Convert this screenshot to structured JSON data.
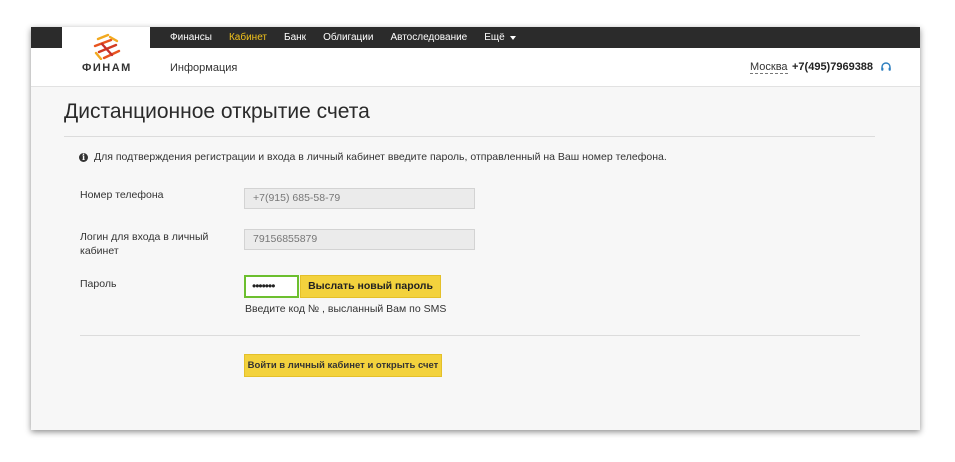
{
  "header": {
    "logo_text": "ФИНАМ",
    "top_nav": [
      {
        "label": "Финансы",
        "active": false
      },
      {
        "label": "Кабинет",
        "active": true
      },
      {
        "label": "Банк",
        "active": false
      },
      {
        "label": "Облигации",
        "active": false
      },
      {
        "label": "Автоследование",
        "active": false
      },
      {
        "label": "Ещё",
        "active": false
      }
    ],
    "sub_nav_label": "Информация",
    "city": "Москва",
    "phone": "+7(495)7969388",
    "headset_icon": "headset-icon",
    "colors": {
      "topbar": "#2b2b2b",
      "active_nav": "#f2c21b",
      "accent_button": "#f3d23d"
    }
  },
  "main": {
    "title": "Дистанционное открытие счета",
    "info_text": "Для подтверждения регистрации и входа в личный кабинет введите пароль, отправленный на Ваш номер телефона.",
    "phone_label": "Номер телефона",
    "phone_value": "+7(915) 685-58-79",
    "login_label": "Логин для входа в личный кабинет",
    "login_value": "79156855879",
    "password_label": "Пароль",
    "password_value": "•••••••",
    "resend_button": "Выслать новый пароль",
    "hint": "Введите код № , высланный Вам по SMS",
    "submit_button": "Войти в личный кабинет и открыть счет"
  }
}
